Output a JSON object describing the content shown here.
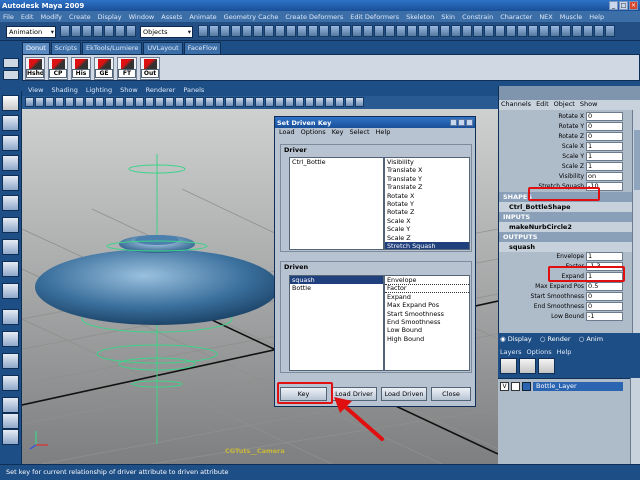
{
  "window": {
    "title": "Autodesk Maya 2009"
  },
  "menubar": [
    "File",
    "Edit",
    "Modify",
    "Create",
    "Display",
    "Window",
    "Assets",
    "Animate",
    "Geometry Cache",
    "Create Deformers",
    "Edit Deformers",
    "Skeleton",
    "Skin",
    "Constrain",
    "Character",
    "NEX",
    "Muscle",
    "Help"
  ],
  "status": {
    "mode": "Animation",
    "selection_mode": "Objects"
  },
  "shelf": {
    "tabs": [
      "Donut",
      "Scripts",
      "EkTools/Lumiere",
      "UVLayout",
      "FaceFlow"
    ],
    "active_tab": "Donut",
    "buttons": [
      "Hshd",
      "CP",
      "His",
      "GE",
      "FT",
      "Out"
    ]
  },
  "viewport": {
    "menu": [
      "View",
      "Shading",
      "Lighting",
      "Show",
      "Renderer",
      "Panels"
    ],
    "camera_label": "CGTuts__Camera"
  },
  "dialog": {
    "title": "Set Driven Key",
    "menu": [
      "Load",
      "Options",
      "Key",
      "Select",
      "Help"
    ],
    "driver": {
      "label": "Driver",
      "objects": [
        "Ctrl_Bottle"
      ],
      "attributes": [
        "Visibility",
        "Translate X",
        "Translate Y",
        "Translate Z",
        "Rotate X",
        "Rotate Y",
        "Rotate Z",
        "Scale X",
        "Scale Y",
        "Scale Z",
        "Stretch Squash"
      ],
      "selected_attribute": "Stretch Squash"
    },
    "driven": {
      "label": "Driven",
      "objects": [
        "squash",
        "Bottle"
      ],
      "selected_object": "squash",
      "attributes": [
        "Envelope",
        "Factor",
        "Expand",
        "Max Expand Pos",
        "Start Smoothness",
        "End Smoothness",
        "Low Bound",
        "High Bound"
      ],
      "selected_attribute": "Factor"
    },
    "buttons": {
      "key": "Key",
      "load_driver": "Load Driver",
      "load_driven": "Load Driven",
      "close": "Close"
    }
  },
  "channelbox": {
    "menu": [
      "Channels",
      "Edit",
      "Object",
      "Show"
    ],
    "transform_rows": [
      {
        "label": "Rotate X",
        "value": "0"
      },
      {
        "label": "Rotate Y",
        "value": "0"
      },
      {
        "label": "Rotate Z",
        "value": "0"
      },
      {
        "label": "Scale X",
        "value": "1"
      },
      {
        "label": "Scale Y",
        "value": "1"
      },
      {
        "label": "Scale Z",
        "value": "1"
      },
      {
        "label": "Visibility",
        "value": "on"
      },
      {
        "label": "Stretch Squash",
        "value": "-10"
      }
    ],
    "shapes_header": "SHAPES",
    "shape_node": "Ctrl_BottleShape",
    "inputs_header": "INPUTS",
    "input_node": "makeNurbCircle2",
    "outputs_header": "OUTPUTS",
    "output_node": "squash",
    "output_rows": [
      {
        "label": "Envelope",
        "value": "1"
      },
      {
        "label": "Factor",
        "value": "-1.3"
      },
      {
        "label": "Expand",
        "value": "1"
      },
      {
        "label": "Max Expand Pos",
        "value": "0.5"
      },
      {
        "label": "Start Smoothness",
        "value": "0"
      },
      {
        "label": "End Smoothness",
        "value": "0"
      },
      {
        "label": "Low Bound",
        "value": "-1"
      }
    ]
  },
  "layers": {
    "radios": [
      "Display",
      "Render",
      "Anim"
    ],
    "menu": [
      "Layers",
      "Options",
      "Help"
    ],
    "layer": {
      "visible": "V",
      "name": "Bottle_Layer"
    }
  },
  "helpline": "Set key for current relationship of driver attribute to driven attribute",
  "colors": {
    "accent_highlight": "#e01010",
    "selection": "#1f3f7d",
    "ui_background": "#1d4e86"
  }
}
